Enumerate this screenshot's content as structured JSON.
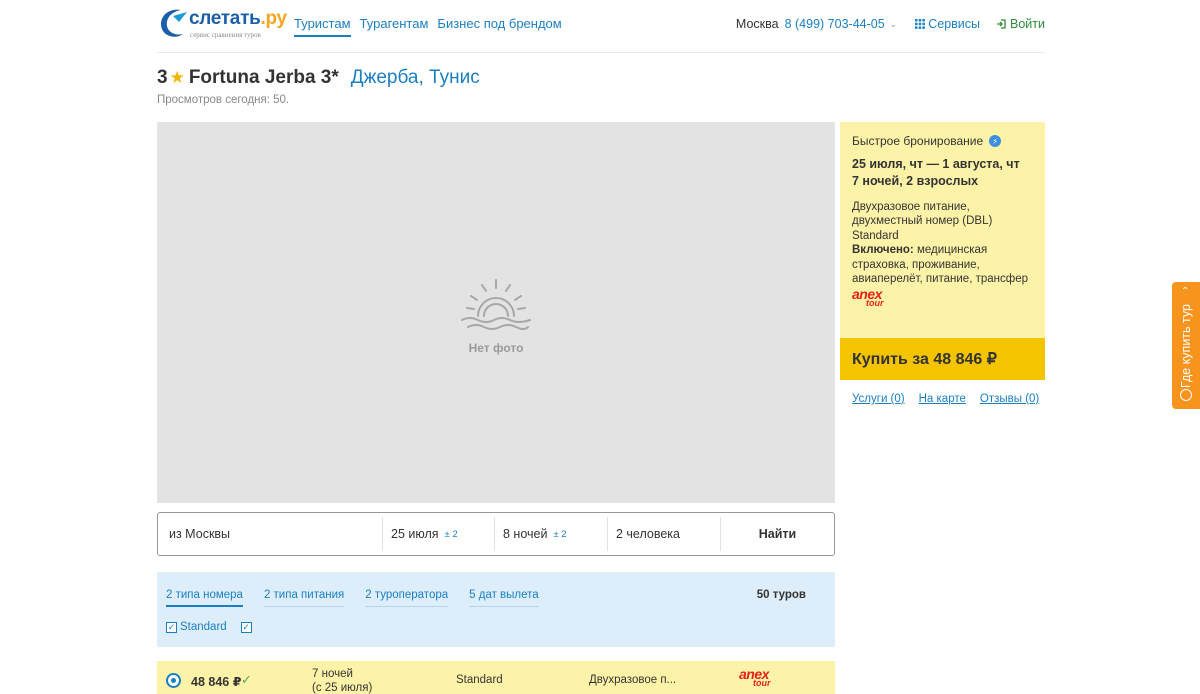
{
  "header": {
    "logo_text": "слетать",
    "logo_tld": ".ру",
    "logo_sub": "сервис сравнения туров",
    "nav": [
      "Туристам",
      "Турагентам",
      "Бизнес под брендом"
    ],
    "city": "Москва",
    "phone": "8 (499) 703-44-05",
    "services": "Сервисы",
    "login": "Войти"
  },
  "hotel": {
    "stars": "3",
    "name": "Fortuna Jerba 3*",
    "location": "Джерба, Тунис",
    "views": "Просмотров сегодня: 50."
  },
  "photo": {
    "no_photo": "Нет фото"
  },
  "booking": {
    "title": "Быстрое бронирование",
    "dates": "25 июля, чт — 1 августа, чт",
    "nights": "7 ночей, 2 взрослых",
    "meal_room": "Двухразовое питание, двухместный номер (DBL) Standard",
    "included_label": "Включено:",
    "included": "медицинская страховка, проживание, авиаперелёт, питание, трансфер",
    "operator": "anex tour",
    "buy": "Купить за 48 846 ₽",
    "links": [
      "Услуги (0)",
      "На карте",
      "Отзывы (0)"
    ]
  },
  "search": {
    "from": "из Москвы",
    "date": "25 июля",
    "date_pm": "± 2",
    "nights": "8 ночей",
    "nights_pm": "± 2",
    "people": "2 человека",
    "find": "Найти"
  },
  "filters": {
    "tabs": [
      "2 типа номера",
      "2 типа питания",
      "2 туроператора",
      "5 дат вылета"
    ],
    "tours_count": "50 туров",
    "checkbox_label": "Standard"
  },
  "result": {
    "price": "48 846 ₽",
    "nights": "7 ночей",
    "from_date": "(с 25 июля)",
    "room": "Standard",
    "meal": "Двухразовое п..."
  },
  "side_tab": {
    "label": "Где купить тур"
  },
  "colors": {
    "accent": "#1a7fc1",
    "booking_bg": "#fdf3a8",
    "buy_button": "#f5c400",
    "side_tab": "#f7941d",
    "filters_bg": "#ddeefa"
  }
}
